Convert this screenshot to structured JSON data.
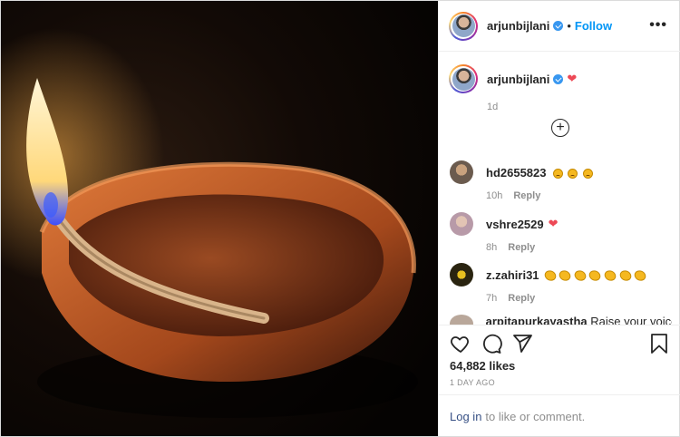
{
  "post": {
    "username": "arjunbijlani",
    "follow_label": "Follow",
    "separator": "•",
    "more_label": "•••"
  },
  "caption": {
    "username": "arjunbijlani",
    "emoji": "❤",
    "time": "1d"
  },
  "load_more_label": "+",
  "comments": [
    {
      "user": "hd2655823",
      "time": "10h",
      "reply": "Reply"
    },
    {
      "user": "vshre2529",
      "emoji": "❤",
      "time": "8h",
      "reply": "Reply"
    },
    {
      "user": "z.zahiri31",
      "time": "7h",
      "reply": "Reply"
    }
  ],
  "partial_comment": {
    "user": "arpitapurkayastha",
    "text": "Raise your voice"
  },
  "actions": {
    "likes": "64,882 likes",
    "date": "1 DAY AGO"
  },
  "login": {
    "link": "Log in",
    "text": "to like or comment."
  },
  "colors": {
    "accent": "#0095f6",
    "verified": "#3897f0",
    "heart": "#ed4956"
  },
  "icons": [
    "verified-badge-icon",
    "more-options-icon",
    "add-comment-icon",
    "like-icon",
    "comment-icon",
    "share-icon",
    "save-icon"
  ]
}
